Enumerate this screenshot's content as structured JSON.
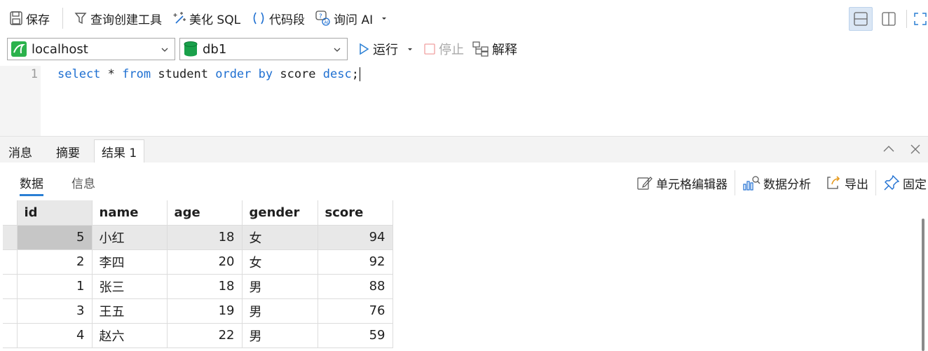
{
  "toolbar": {
    "save": "保存",
    "query_builder": "查询创建工具",
    "beautify": "美化 SQL",
    "snippet": "代码段",
    "ask_ai": "询问 AI"
  },
  "connection": {
    "server": "localhost",
    "database": "db1"
  },
  "run_bar": {
    "run": "运行",
    "stop": "停止",
    "explain": "解释"
  },
  "editor": {
    "line_number": "1",
    "sql": {
      "kw_select": "select",
      "star": " * ",
      "kw_from": "from",
      "table": " student ",
      "kw_order_by": "order by",
      "column": " score ",
      "kw_desc": "desc",
      "end": ";"
    }
  },
  "tabs": [
    "消息",
    "摘要",
    "结果 1"
  ],
  "subtabs": [
    "数据",
    "信息"
  ],
  "result_tools": {
    "cell_editor": "单元格编辑器",
    "analysis": "数据分析",
    "export": "导出",
    "pin": "固定"
  },
  "grid": {
    "columns": [
      "id",
      "name",
      "age",
      "gender",
      "score"
    ],
    "rows": [
      [
        "5",
        "小红",
        "18",
        "女",
        "94"
      ],
      [
        "2",
        "李四",
        "20",
        "女",
        "92"
      ],
      [
        "1",
        "张三",
        "18",
        "男",
        "88"
      ],
      [
        "3",
        "王五",
        "19",
        "男",
        "76"
      ],
      [
        "4",
        "赵六",
        "22",
        "男",
        "59"
      ]
    ]
  },
  "colors": {
    "accent": "#2a7fd4",
    "keyword": "#1e6fd1",
    "mysql_green": "#2bb24c",
    "db_green": "#19a04a"
  }
}
